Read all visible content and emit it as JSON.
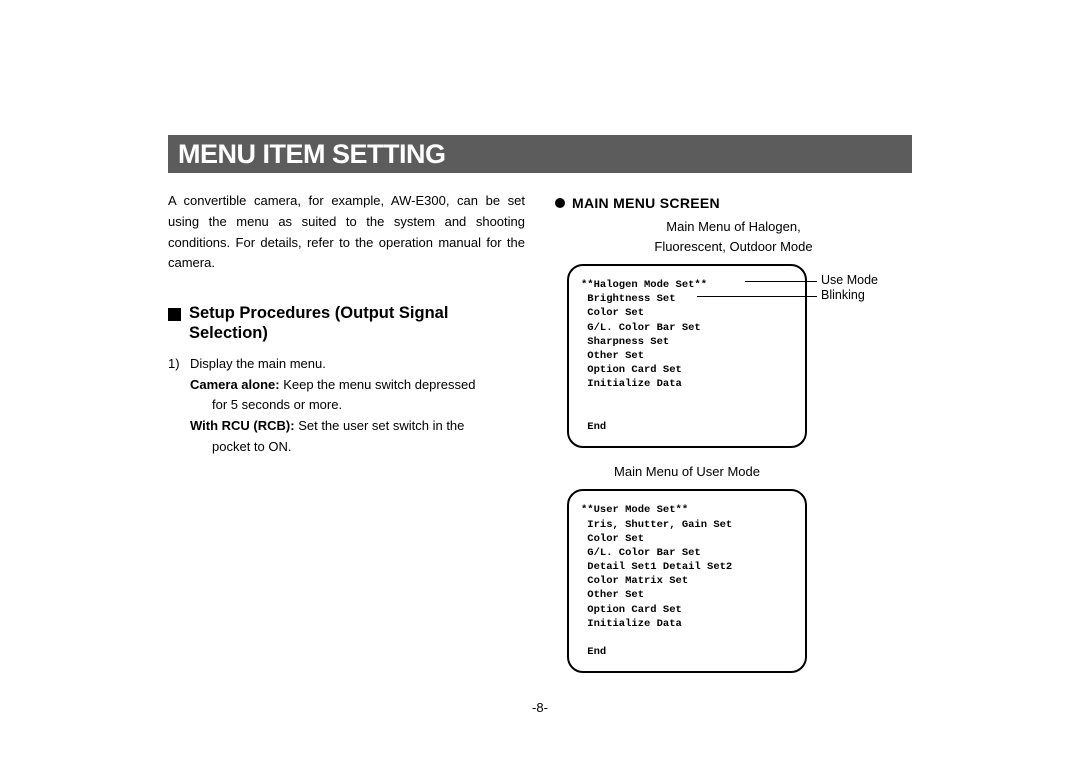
{
  "title": "MENU ITEM SETTING",
  "intro": "A convertible camera, for example, AW-E300, can be set using the menu as suited to the system and shooting conditions.  For details, refer to the operation manual for the camera.",
  "section1": {
    "heading": "Setup Procedures (Output Signal Selection)",
    "step_num": "1)",
    "step_main": "Display the main menu.",
    "camera_alone_label": "Camera alone:",
    "camera_alone_text": " Keep the menu switch depressed",
    "camera_alone_cont": "for 5 seconds or more.",
    "with_rcu_label": "With RCU (RCB):",
    "with_rcu_text": " Set the user set switch in the",
    "with_rcu_cont": "pocket to ON."
  },
  "right": {
    "heading": "MAIN MENU SCREEN",
    "caption1": "Main Menu of Halogen,\nFluorescent, Outdoor Mode",
    "screen1": "**Halogen Mode Set**\n Brightness Set\n Color Set\n G/L. Color Bar Set\n Sharpness Set\n Other Set\n Option Card Set\n Initialize Data\n\n\n End",
    "annot1": "Use Mode",
    "annot2": "Blinking",
    "caption2": "Main Menu of User Mode",
    "screen2": "**User Mode Set**\n Iris, Shutter, Gain Set\n Color Set\n G/L. Color Bar Set\n Detail Set1 Detail Set2\n Color Matrix Set\n Other Set\n Option Card Set\n Initialize Data\n\n End"
  },
  "page_number": "-8-"
}
